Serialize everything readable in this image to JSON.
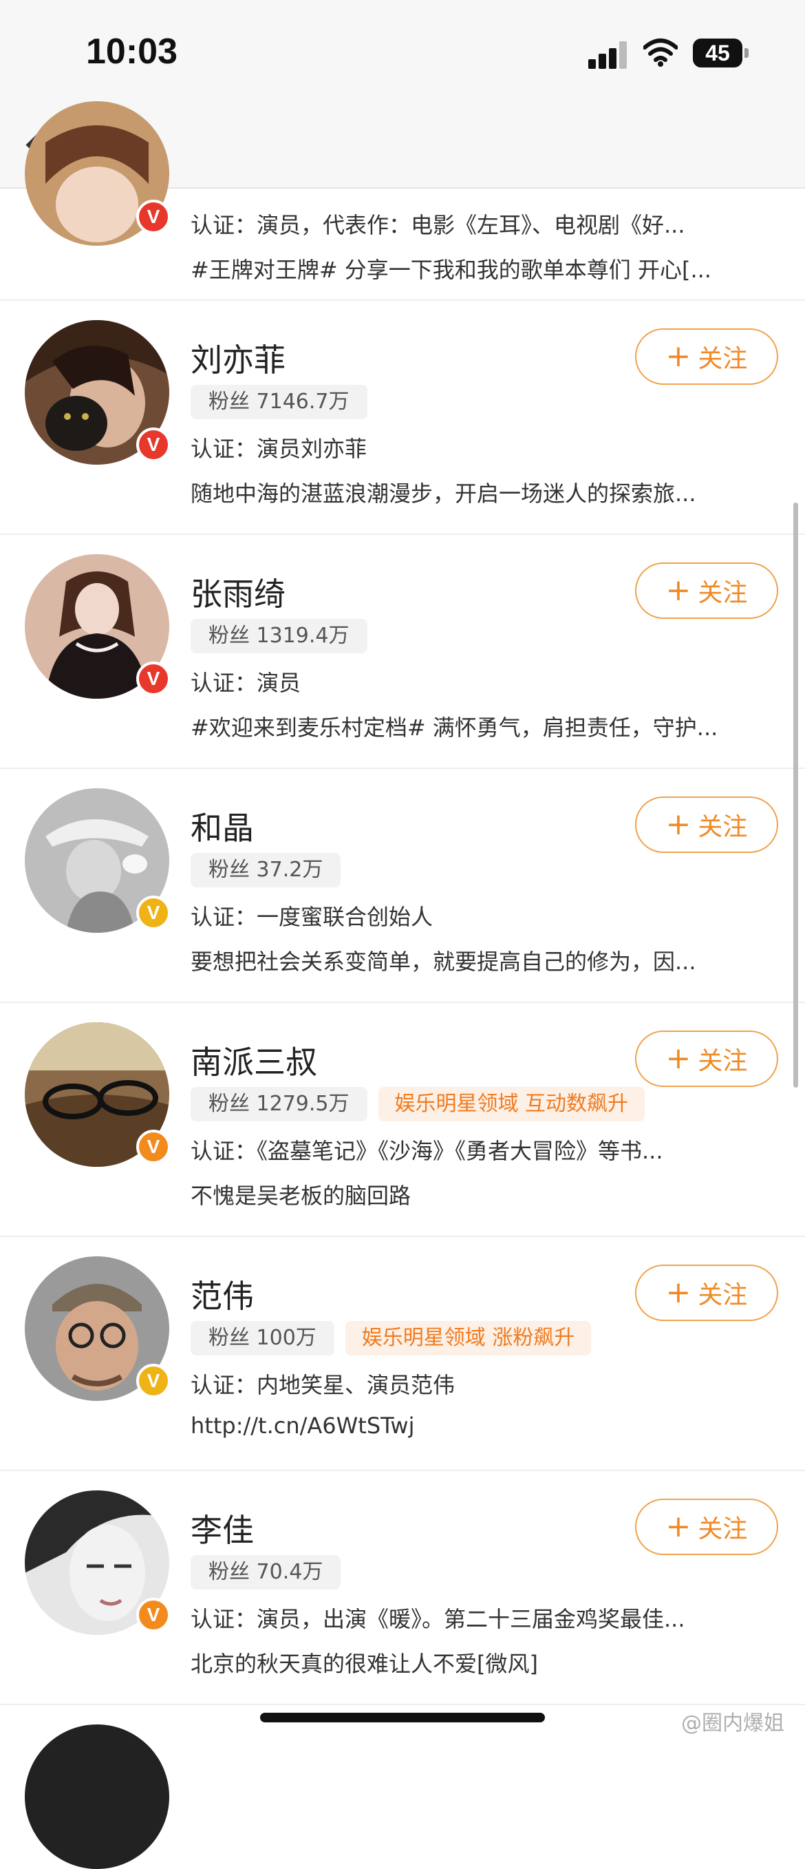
{
  "status_bar": {
    "time": "10:03",
    "battery": "45"
  },
  "nav": {
    "back_label": "返回"
  },
  "follow_label": "关注",
  "users": [
    {
      "partial": true,
      "verify": "red",
      "cert": "认证：演员，代表作：电影《左耳》、电视剧《好...",
      "desc": "#王牌对王牌# 分享一下我和我的歌单本尊们 开心[..."
    },
    {
      "name": "刘亦菲",
      "fans": "粉丝 7146.7万",
      "verify": "red",
      "cert": "认证：演员刘亦菲",
      "desc": "随地中海的湛蓝浪潮漫步，开启一场迷人的探索旅..."
    },
    {
      "name": "张雨绮",
      "fans": "粉丝 1319.4万",
      "verify": "red",
      "cert": "认证：演员",
      "desc": "#欢迎来到麦乐村定档# 满怀勇气，肩担责任，守护..."
    },
    {
      "name": "和晶",
      "fans": "粉丝 37.2万",
      "verify": "yellow",
      "cert": "认证：一度蜜联合创始人",
      "desc": "要想把社会关系变简单，就要提高自己的修为，因..."
    },
    {
      "name": "南派三叔",
      "fans": "粉丝 1279.5万",
      "badge": "娱乐明星领域 互动数飙升",
      "verify": "orange",
      "cert": "认证：《盗墓笔记》《沙海》《勇者大冒险》等书...",
      "desc": "不愧是吴老板的脑回路"
    },
    {
      "name": "范伟",
      "fans": "粉丝 100万",
      "badge": "娱乐明星领域 涨粉飙升",
      "verify": "yellow",
      "cert": "认证：内地笑星、演员范伟",
      "desc": "http://t.cn/A6WtSTwj"
    },
    {
      "name": "李佳",
      "fans": "粉丝 70.4万",
      "verify": "orange",
      "cert": "认证：演员，出演《暖》。第二十三届金鸡奖最佳...",
      "desc": "北京的秋天真的很难让人不爱[微风]"
    }
  ],
  "watermark": "@圈内爆姐",
  "colors": {
    "accent": "#f08a24",
    "verify_red": "#e8372b",
    "verify_orange": "#f28a1c",
    "verify_yellow": "#efb316"
  }
}
